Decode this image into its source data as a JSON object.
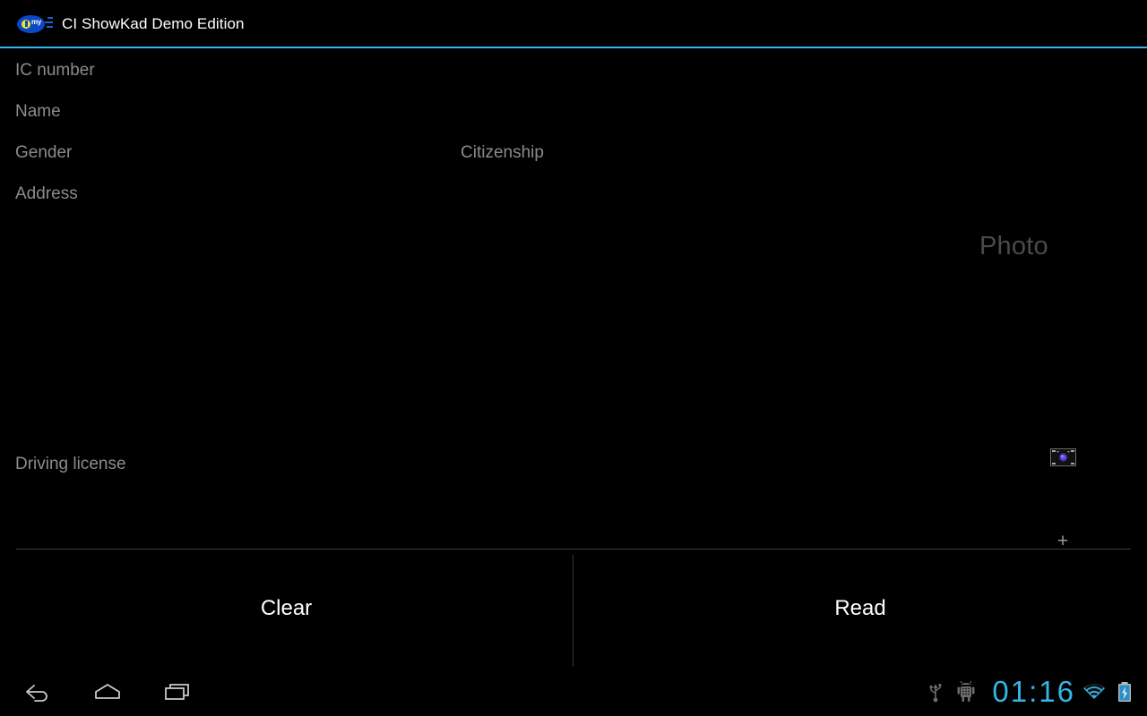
{
  "titlebar": {
    "app_icon_name": "mykad-logo-icon",
    "app_icon_text": "my",
    "title": "CI ShowKad Demo Edition",
    "accent_color": "#33b5e5"
  },
  "form": {
    "labels": {
      "ic_number": "IC number",
      "name": "Name",
      "gender": "Gender",
      "citizenship": "Citizenship",
      "address": "Address",
      "driving_license": "Driving license"
    },
    "values": {
      "ic_number": "",
      "name": "",
      "gender": "",
      "citizenship": "",
      "address": "",
      "driving_license": ""
    },
    "photo": {
      "label": "Photo",
      "placeholder_icon": "camera-placeholder-icon"
    },
    "add_button_label": "+",
    "label_color": "#8b8b8b",
    "photo_label_color": "#4a4a4a"
  },
  "actions": {
    "clear_label": "Clear",
    "read_label": "Read"
  },
  "navbar": {
    "back_icon": "back-icon",
    "home_icon": "home-icon",
    "recents_icon": "recent-apps-icon",
    "usb_icon": "usb-icon",
    "adb_icon": "android-debug-icon",
    "wifi_icon": "wifi-icon",
    "battery_icon": "battery-charging-icon",
    "clock": "01:16",
    "clock_color": "#33b5e5"
  }
}
